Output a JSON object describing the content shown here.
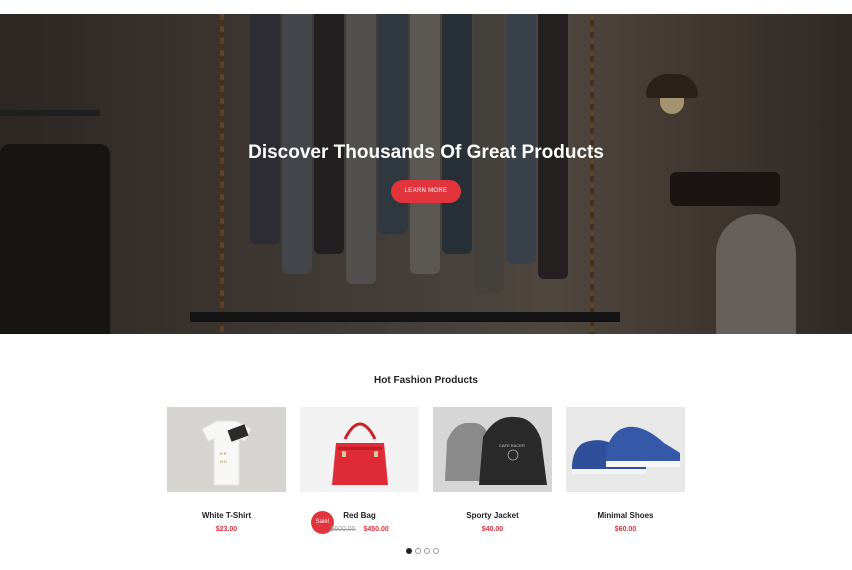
{
  "hero": {
    "title": "Discover Thousands Of Great Products",
    "cta_label": "LEARN MORE"
  },
  "section": {
    "title": "Hot Fashion Products"
  },
  "products": [
    {
      "name": "White T-Shirt",
      "price": "$23.00",
      "image_icon": "tshirt-icon"
    },
    {
      "name": "Red Bag",
      "old_price": "$600.00",
      "price": "$450.00",
      "badge": "Sale!",
      "image_icon": "handbag-icon"
    },
    {
      "name": "Sporty Jacket",
      "price": "$40.00",
      "image_icon": "hoodie-icon"
    },
    {
      "name": "Minimal Shoes",
      "price": "$60.00",
      "image_icon": "sneaker-icon"
    }
  ],
  "carousel": {
    "pages": 4,
    "active": 1
  },
  "colors": {
    "accent": "#e2343c",
    "text": "#222222"
  }
}
